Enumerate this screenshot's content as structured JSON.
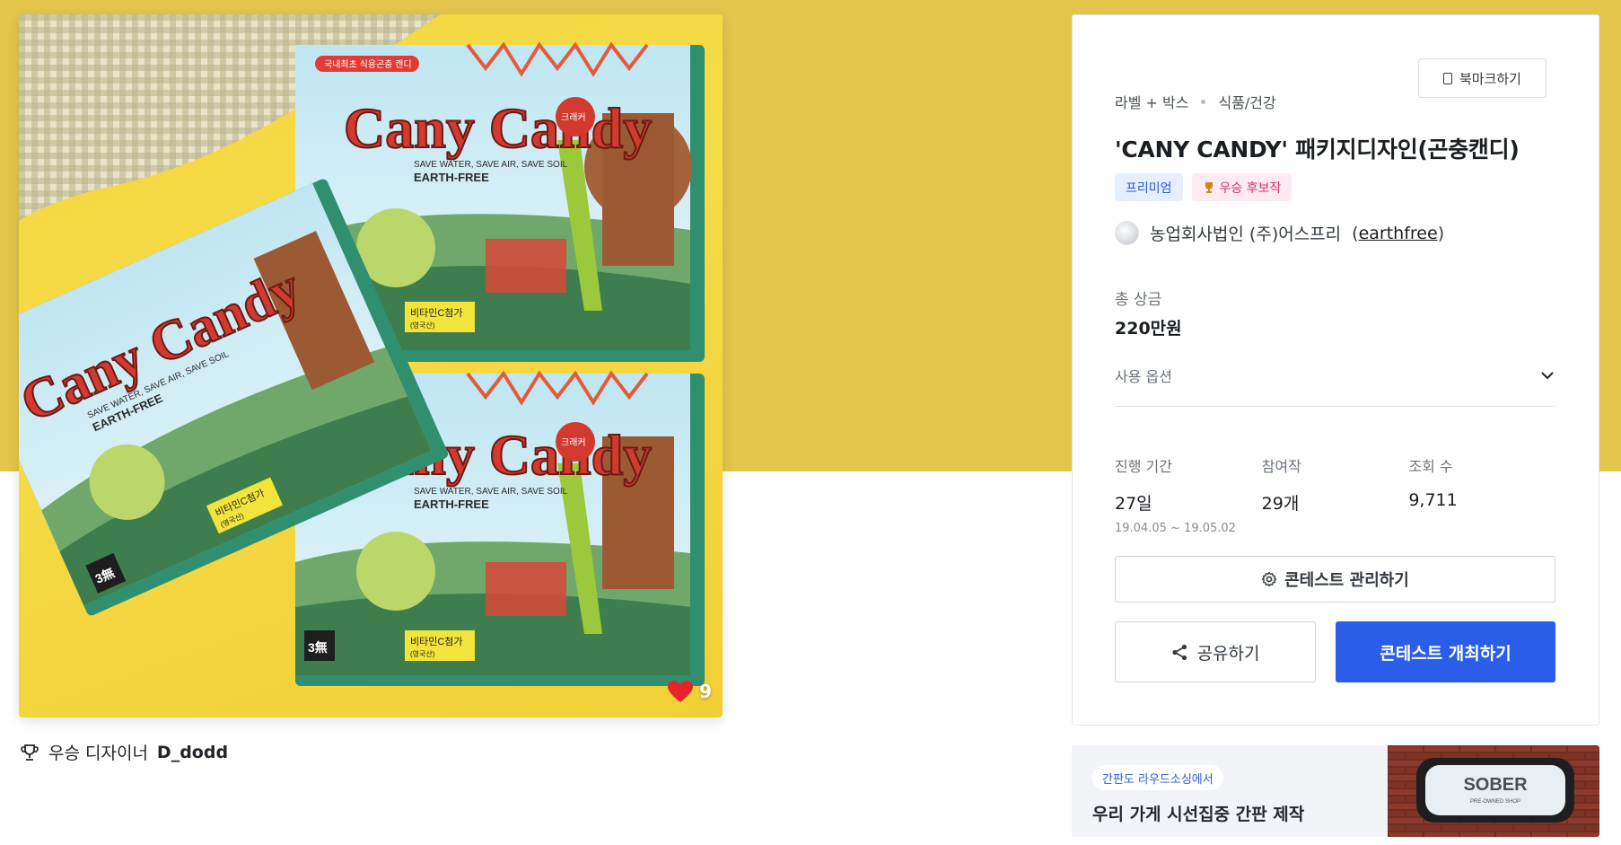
{
  "artwork": {
    "alt": "Cany Candy package artwork",
    "brand_text": "Cany Candy",
    "tagline": "SAVE WATER, SAVE AIR, SAVE SOIL",
    "sub_tagline": "EARTH-FREE",
    "corner_label": "국내최초 식용곤충 캔디",
    "flavor_badge": "크래커",
    "vitamin_label": "비타민C첨가",
    "vitamin_sub": "(영국산)",
    "three_free": "3無",
    "like_count": "9"
  },
  "winner": {
    "prefix": "우승 디자이너",
    "name": "D_dodd"
  },
  "contest": {
    "bookmark_label": "북마크하기",
    "category_main": "라벨 + 박스",
    "category_sub": "식품/건강",
    "title": "'CANY CANDY' 패키지디자인(곤충캔디)",
    "badges": [
      {
        "label": "프리미엄",
        "type": "premium"
      },
      {
        "label": "우승 후보작",
        "type": "candidate"
      }
    ],
    "host_name": "농업회사법인 (주)어스프리",
    "host_handle": "earthfree",
    "prize_label": "총 상금",
    "prize_value": "220만원",
    "usage_label": "사용 옵션",
    "stats": [
      {
        "label": "진행 기간",
        "value": "27일",
        "sub": "19.04.05  ~  19.05.02"
      },
      {
        "label": "참여작",
        "value": "29개",
        "sub": ""
      },
      {
        "label": "조회 수",
        "value": "9,711",
        "sub": ""
      }
    ],
    "manage_label": "콘테스트 관리하기",
    "share_label": "공유하기",
    "host_contest_label": "콘테스트 개최하기"
  },
  "ad": {
    "tag": "간판도 라우드소싱에서",
    "headline": "우리 가게 시선집중 간판 제작",
    "sign_text": "SOBER",
    "sign_sub": "PRE-OWNED SHOP"
  },
  "colors": {
    "band": "#e3c54c",
    "primary": "#2a5ee8",
    "premium_bg": "#e6efff",
    "candidate_bg": "#fdeaf2",
    "heart": "#e8242b"
  }
}
